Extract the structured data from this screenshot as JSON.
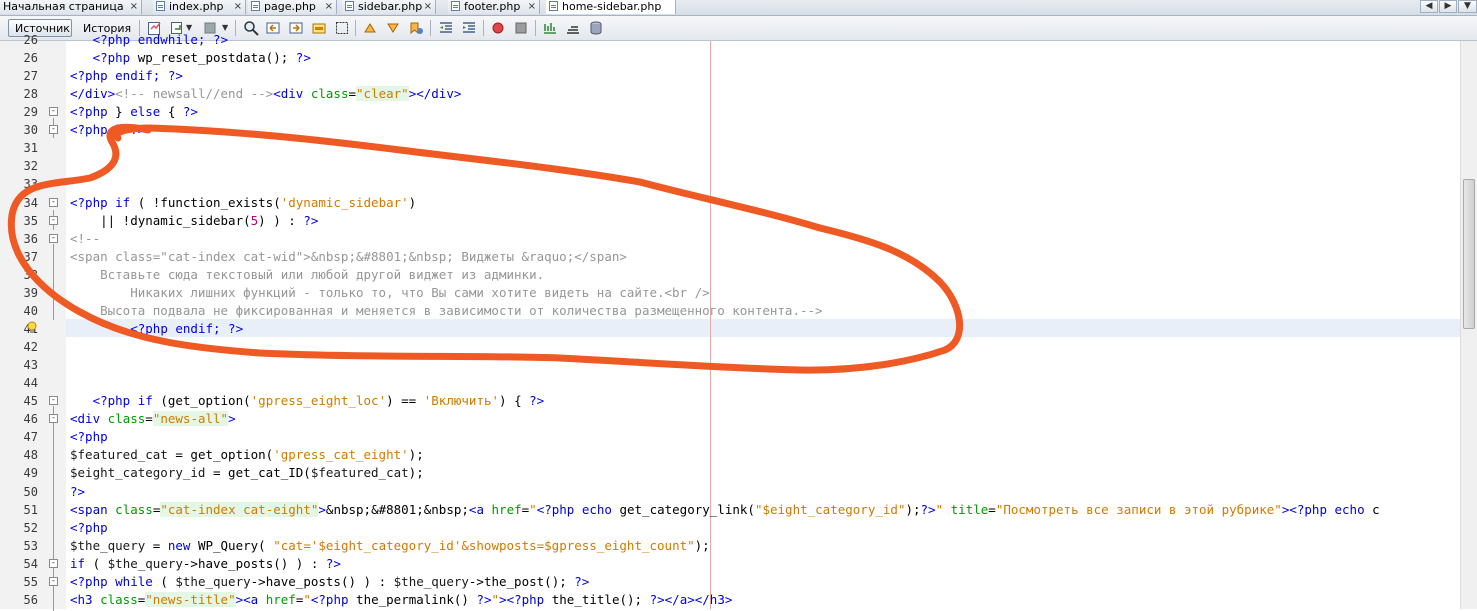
{
  "tabs": [
    {
      "label": "Начальная страница",
      "active": false
    },
    {
      "label": "index.php",
      "active": false
    },
    {
      "label": "page.php",
      "active": false
    },
    {
      "label": "sidebar.php",
      "active": false
    },
    {
      "label": "footer.php",
      "active": false
    },
    {
      "label": "home-sidebar.php",
      "active": true
    }
  ],
  "toolbar": {
    "source_label": "Источник",
    "history_label": "История"
  },
  "editor": {
    "highlighted_line": "41",
    "lines": [
      {
        "n": "26",
        "fold": "",
        "html": "   <span class=\"k\">&lt;?php endwhile; ?&gt;</span>"
      },
      {
        "n": "26",
        "fold": "",
        "html": "   <span class=\"k\">&lt;?php</span> wp_reset_postdata(); <span class=\"k\">?&gt;</span>"
      },
      {
        "n": "27",
        "fold": "",
        "html": "<span class=\"k\">&lt;?php endif; ?&gt;</span>"
      },
      {
        "n": "28",
        "fold": "",
        "html": "<span class=\"t\">&lt;/div&gt;</span><span class=\"c\">&lt;!-- newsall//end --&gt;</span><span class=\"t\">&lt;div</span> <span class=\"a\">class</span>=<span class=\"av\">\"clear\"</span><span class=\"t\">&gt;&lt;/div&gt;</span>"
      },
      {
        "n": "29",
        "fold": "-",
        "html": "<span class=\"k\">&lt;?php</span> } <span class=\"k\">else</span> { <span class=\"k\">?&gt;</span>"
      },
      {
        "n": "30",
        "fold": "-",
        "html": "<span class=\"k\">&lt;?php</span> } <span class=\"k\">?&gt;</span>"
      },
      {
        "n": "31",
        "fold": "",
        "html": ""
      },
      {
        "n": "32",
        "fold": "",
        "html": ""
      },
      {
        "n": "33",
        "fold": "",
        "html": ""
      },
      {
        "n": "34",
        "fold": "-",
        "html": "<span class=\"k\">&lt;?php if</span> ( !function_exists(<span class=\"s\">'dynamic_sidebar'</span>)"
      },
      {
        "n": "35",
        "fold": "-",
        "html": "    || !dynamic_sidebar(<span class=\"num\">5</span>) ) : <span class=\"k\">?&gt;</span>"
      },
      {
        "n": "36",
        "fold": "-",
        "html": "<span class=\"c\">&lt;!--</span>"
      },
      {
        "n": "37",
        "fold": "",
        "html": "<span class=\"c\">&lt;span class=\"cat-index cat-wid\"&gt;&amp;nbsp;&amp;#8801;&amp;nbsp; Виджеты &amp;raquo;&lt;/span&gt;</span>"
      },
      {
        "n": "38",
        "fold": "",
        "html": "<span class=\"c\">    Вставьте сюда текстовый или любой другой виджет из админки.</span>"
      },
      {
        "n": "39",
        "fold": "",
        "html": "<span class=\"c\">        Никаких лишних функций - только то, что Вы сами хотите видеть на сайте.&lt;br /&gt;</span>"
      },
      {
        "n": "40",
        "fold": "",
        "html": "<span class=\"c\">    Высота подвала не фиксированная и меняется в зависимости от количества размещенного контента.--&gt;</span>"
      },
      {
        "n": "41",
        "fold": "",
        "html": "        <span class=\"k\">&lt;?php endif; ?&gt;</span>"
      },
      {
        "n": "42",
        "fold": "",
        "html": ""
      },
      {
        "n": "43",
        "fold": "",
        "html": ""
      },
      {
        "n": "44",
        "fold": "",
        "html": ""
      },
      {
        "n": "45",
        "fold": "-",
        "html": "   <span class=\"k\">&lt;?php if</span> (get_option(<span class=\"s\">'gpress_eight_loc'</span>) == <span class=\"s\">'Включить'</span>) { <span class=\"k\">?&gt;</span>"
      },
      {
        "n": "46",
        "fold": "-",
        "html": "<span class=\"t\">&lt;div</span> <span class=\"a\">class</span>=<span class=\"av\">\"news-all\"</span><span class=\"t\">&gt;</span>"
      },
      {
        "n": "47",
        "fold": "",
        "html": "<span class=\"k\">&lt;?php</span>"
      },
      {
        "n": "48",
        "fold": "",
        "html": "<span class=\"v\">$featured_cat</span> = get_option(<span class=\"s\">'gpress_cat_eight'</span>);"
      },
      {
        "n": "49",
        "fold": "",
        "html": "<span class=\"v\">$eight_category_id</span> = get_cat_ID(<span class=\"v\">$featured_cat</span>);"
      },
      {
        "n": "50",
        "fold": "",
        "html": "<span class=\"k\">?&gt;</span>"
      },
      {
        "n": "51",
        "fold": "",
        "html": "<span class=\"t\">&lt;span</span> <span class=\"a\">class</span>=<span class=\"av\">\"cat-index cat-eight\"</span><span class=\"t\">&gt;</span>&amp;nbsp;&amp;#8801;&amp;nbsp;<span class=\"t\">&lt;a</span> <span class=\"a\">href</span>=<span class=\"s\">\"</span><span class=\"k\">&lt;?php echo</span> get_category_link(<span class=\"s\">\"$eight_category_id\"</span>);<span class=\"k\">?&gt;</span><span class=\"s\">\"</span> <span class=\"a\">title</span>=<span class=\"s\">\"Посмотреть все записи в этой рубрике\"</span><span class=\"t\">&gt;</span><span class=\"k\">&lt;?php echo</span> c"
      },
      {
        "n": "52",
        "fold": "",
        "html": "<span class=\"k\">&lt;?php</span>"
      },
      {
        "n": "53",
        "fold": "",
        "html": "<span class=\"v\">$the_query</span> = <span class=\"k\">new</span> WP_Query( <span class=\"s\">\"cat='$eight_category_id'&amp;showposts=$gpress_eight_count\"</span>);"
      },
      {
        "n": "54",
        "fold": "-",
        "html": "<span class=\"k\">if</span> ( <span class=\"v\">$the_query</span>-&gt;have_posts() ) : <span class=\"k\">?&gt;</span>"
      },
      {
        "n": "55",
        "fold": "-",
        "html": "<span class=\"k\">&lt;?php while</span> ( <span class=\"v\">$the_query</span>-&gt;have_posts() ) : <span class=\"v\">$the_query</span>-&gt;the_post(); <span class=\"k\">?&gt;</span>"
      },
      {
        "n": "56",
        "fold": "",
        "html": "<span class=\"t\">&lt;h3</span> <span class=\"a\">class</span>=<span class=\"av\">\"news-title\"</span><span class=\"t\">&gt;&lt;a</span> <span class=\"a\">href</span>=<span class=\"s\">\"</span><span class=\"k\">&lt;?php</span> the_permalink() <span class=\"k\">?&gt;</span><span class=\"s\">\"</span><span class=\"t\">&gt;</span><span class=\"k\">&lt;?php</span> the_title(); <span class=\"k\">?&gt;</span><span class=\"t\">&lt;/a&gt;&lt;/h3&gt;</span>"
      }
    ]
  },
  "annotation": {
    "color": "#ef5a24"
  }
}
